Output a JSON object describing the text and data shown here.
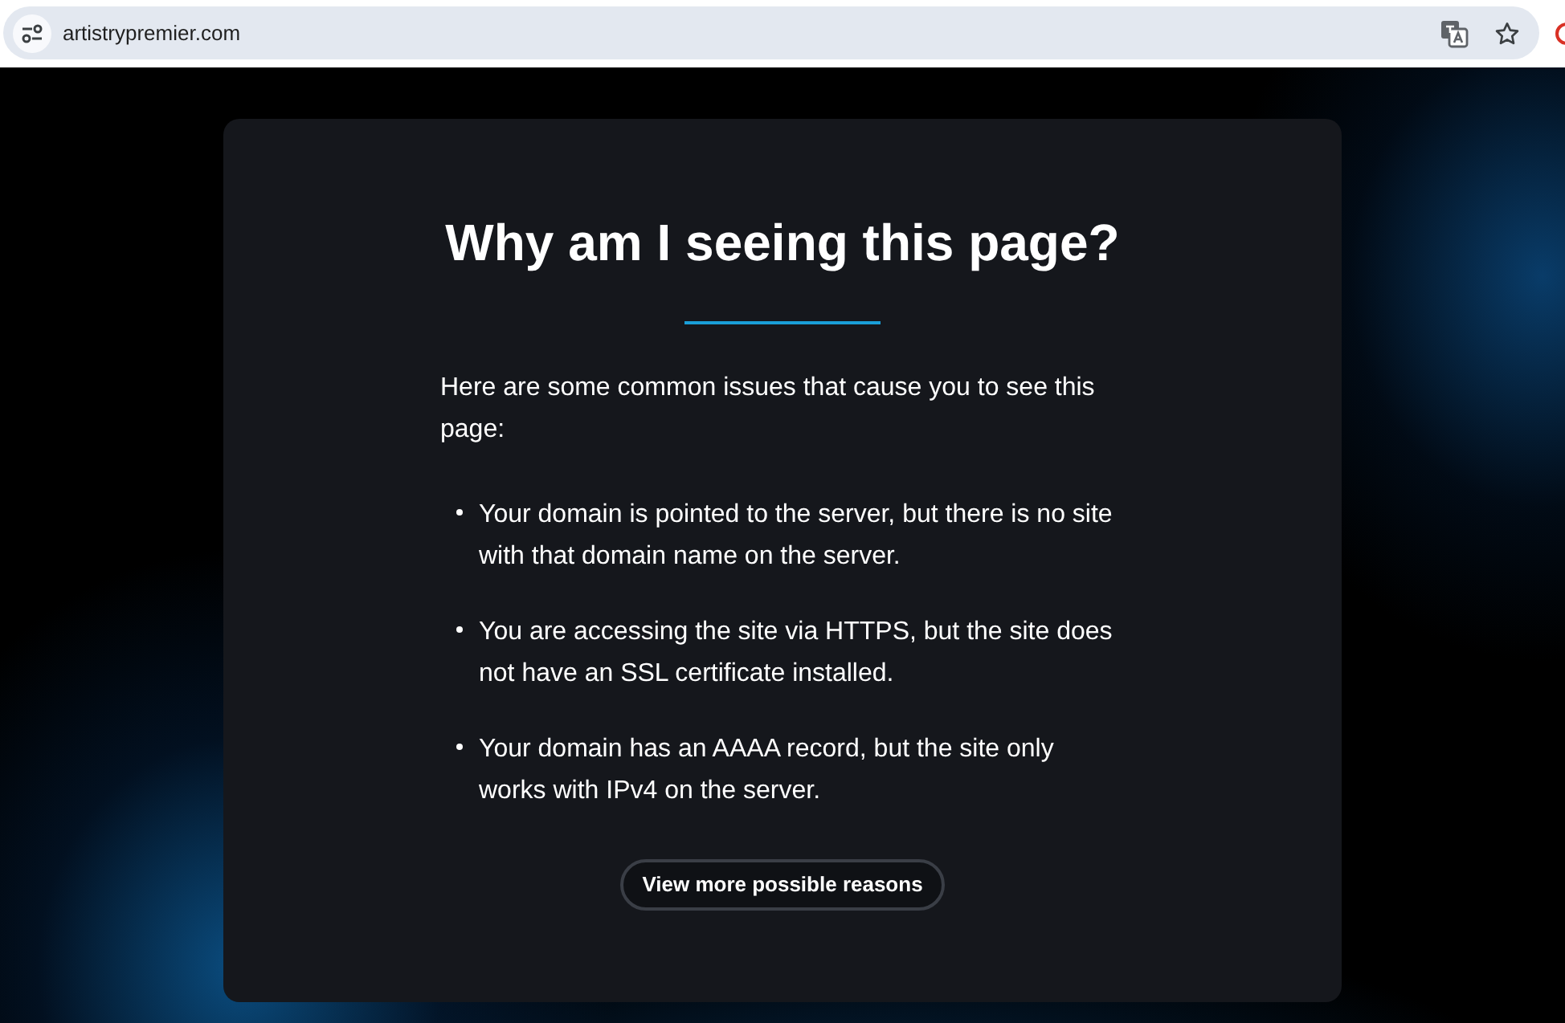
{
  "browser": {
    "url": "artistrypremier.com"
  },
  "card": {
    "title": "Why am I seeing this page?",
    "intro": "Here are some common issues that cause you to see this page:",
    "reasons": [
      "Your domain is pointed to the server, but there is no site with that domain name on the server.",
      "You are accessing the site via HTTPS, but the site does not have an SSL certificate installed.",
      "Your domain has an AAAA record, but the site only works with IPv4 on the server."
    ],
    "button": "View more possible reasons"
  }
}
